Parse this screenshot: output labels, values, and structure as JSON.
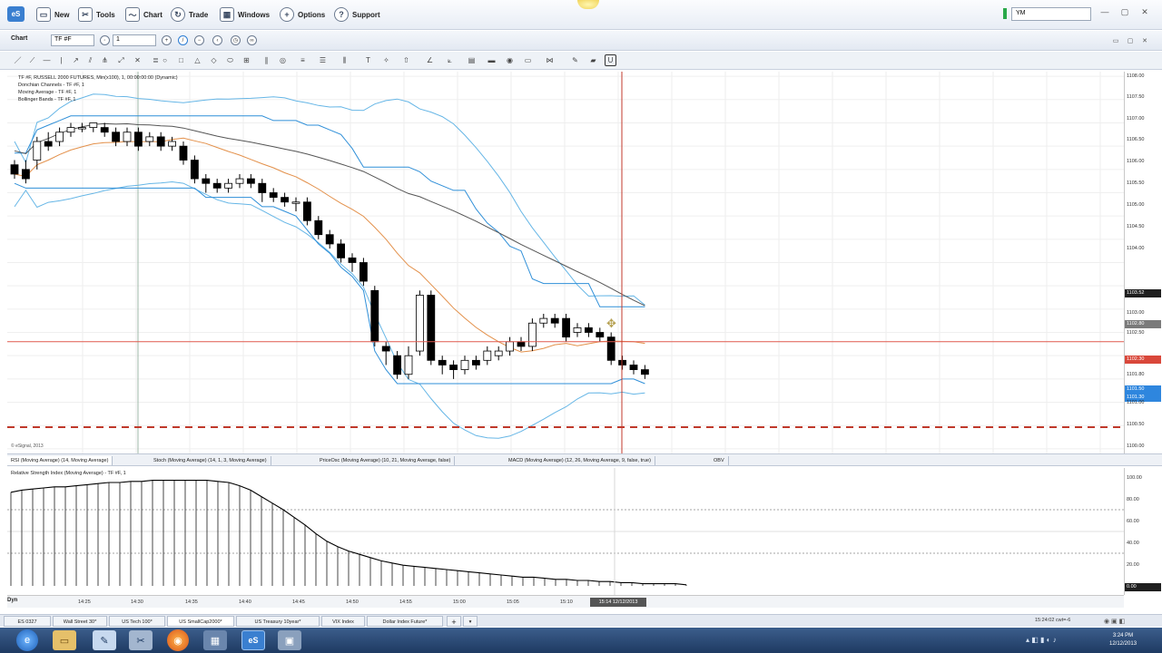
{
  "menu": {
    "items": [
      "New",
      "Tools",
      "Chart",
      "Trade",
      "Windows",
      "Options",
      "Support"
    ],
    "app_logo": "eS",
    "symbol": "YM"
  },
  "toolbar": {
    "chart_label": "Chart",
    "symbol": "TF #F",
    "interval": "1"
  },
  "chart_info": {
    "title": "TF #F, RUSSELL 2000 FUTURES, Min(x100), 1, 00:00:00:00 (Dynamic)",
    "studies": [
      "Donchian Channels - TF #F, 1",
      "Moving Average - TF #F, 1",
      "Bollinger Bands - TF #F, 1"
    ],
    "copyright": "© eSignal, 2013"
  },
  "price_axis": {
    "labels": [
      "1108.00",
      "1107.50",
      "1107.00",
      "1106.50",
      "1106.00",
      "1105.50",
      "1105.00",
      "1104.50",
      "1104.00",
      "1103.00",
      "1102.50",
      "1101.80",
      "1101.00",
      "1100.50",
      "1100.00"
    ],
    "badges": [
      {
        "text": "1103.52",
        "color": "#1f1f1f"
      },
      {
        "text": "1102.80",
        "color": "#7a7a7a"
      },
      {
        "text": "1102.30",
        "color": "#d9473a"
      },
      {
        "text": "1101.50",
        "color": "#2e86de"
      },
      {
        "text": "1101.30",
        "color": "#2e86de"
      }
    ]
  },
  "indicator_tabs": [
    "RSI (Moving Average) (14, Moving Average)",
    "Stoch (Moving Average) (14, 1, 3, Moving Average)",
    "PriceOsc (Moving Average) (10, 21, Moving Average, false)",
    "MACD (Moving Average) (12, 26, Moving Average, 9, false, true)",
    "OBV"
  ],
  "rsi": {
    "title": "Relative Strength Index (Moving Average) - TF #F, 1",
    "axis_labels": [
      "100.00",
      "80.00",
      "60.00",
      "40.00",
      "20.00",
      "0.00"
    ],
    "values": [
      86,
      88,
      89,
      90,
      91,
      91,
      92,
      93,
      94,
      95,
      95,
      96,
      96,
      97,
      97,
      97,
      97,
      97,
      97,
      96,
      95,
      92,
      88,
      82,
      76,
      70,
      63,
      56,
      48,
      41,
      36,
      32,
      29,
      26,
      23,
      21,
      19,
      18,
      17,
      16,
      15,
      14,
      13,
      12,
      11,
      10,
      9,
      8,
      8,
      7,
      6,
      6,
      5,
      5,
      4,
      4,
      3,
      3,
      2,
      2,
      2,
      2,
      1
    ]
  },
  "time_axis": {
    "labels": [
      "14:25",
      "14:30",
      "14:35",
      "14:40",
      "14:45",
      "14:50",
      "14:55",
      "15:00",
      "15:05",
      "15:10"
    ],
    "cursor_label": "15:14 12/12/2013",
    "corner": "Dyn"
  },
  "page_tabs": [
    "ES 0327",
    "Wall Street 30*",
    "US Tech 100*",
    "US SmallCap2000*",
    "US Treasury 10year*",
    "VIX Index",
    "Dollar Index Future*"
  ],
  "page_status": "15:24:02 cwt=-6",
  "taskbar": {
    "time": "3:24 PM",
    "date": "12/12/2013"
  },
  "candles": [
    {
      "o": 1106.1,
      "c": 1105.9,
      "h": 1106.2,
      "l": 1105.8
    },
    {
      "o": 1106.0,
      "c": 1105.8,
      "h": 1106.2,
      "l": 1105.7
    },
    {
      "o": 1106.2,
      "c": 1106.6,
      "h": 1106.7,
      "l": 1106.0
    },
    {
      "o": 1106.6,
      "c": 1106.5,
      "h": 1106.8,
      "l": 1106.4
    },
    {
      "o": 1106.6,
      "c": 1106.8,
      "h": 1106.9,
      "l": 1106.5
    },
    {
      "o": 1106.8,
      "c": 1106.9,
      "h": 1107.0,
      "l": 1106.7
    },
    {
      "o": 1106.9,
      "c": 1106.9,
      "h": 1107.0,
      "l": 1106.8
    },
    {
      "o": 1106.9,
      "c": 1107.0,
      "h": 1107.0,
      "l": 1106.8
    },
    {
      "o": 1106.9,
      "c": 1106.8,
      "h": 1107.0,
      "l": 1106.7
    },
    {
      "o": 1106.8,
      "c": 1106.6,
      "h": 1106.9,
      "l": 1106.5
    },
    {
      "o": 1106.6,
      "c": 1106.8,
      "h": 1106.9,
      "l": 1106.5
    },
    {
      "o": 1106.8,
      "c": 1106.5,
      "h": 1106.9,
      "l": 1106.4
    },
    {
      "o": 1106.6,
      "c": 1106.7,
      "h": 1106.8,
      "l": 1106.5
    },
    {
      "o": 1106.7,
      "c": 1106.5,
      "h": 1106.8,
      "l": 1106.4
    },
    {
      "o": 1106.5,
      "c": 1106.6,
      "h": 1106.7,
      "l": 1106.4
    },
    {
      "o": 1106.5,
      "c": 1106.2,
      "h": 1106.6,
      "l": 1106.1
    },
    {
      "o": 1106.2,
      "c": 1105.8,
      "h": 1106.3,
      "l": 1105.7
    },
    {
      "o": 1105.8,
      "c": 1105.7,
      "h": 1105.9,
      "l": 1105.5
    },
    {
      "o": 1105.7,
      "c": 1105.6,
      "h": 1105.8,
      "l": 1105.5
    },
    {
      "o": 1105.6,
      "c": 1105.7,
      "h": 1105.8,
      "l": 1105.5
    },
    {
      "o": 1105.7,
      "c": 1105.8,
      "h": 1105.9,
      "l": 1105.6
    },
    {
      "o": 1105.8,
      "c": 1105.7,
      "h": 1105.9,
      "l": 1105.6
    },
    {
      "o": 1105.7,
      "c": 1105.5,
      "h": 1105.8,
      "l": 1105.3
    },
    {
      "o": 1105.5,
      "c": 1105.4,
      "h": 1105.6,
      "l": 1105.3
    },
    {
      "o": 1105.4,
      "c": 1105.3,
      "h": 1105.5,
      "l": 1105.2
    },
    {
      "o": 1105.3,
      "c": 1105.3,
      "h": 1105.4,
      "l": 1105.1
    },
    {
      "o": 1105.3,
      "c": 1104.9,
      "h": 1105.4,
      "l": 1104.8
    },
    {
      "o": 1104.9,
      "c": 1104.6,
      "h": 1105.0,
      "l": 1104.5
    },
    {
      "o": 1104.6,
      "c": 1104.4,
      "h": 1104.7,
      "l": 1104.3
    },
    {
      "o": 1104.4,
      "c": 1104.1,
      "h": 1104.5,
      "l": 1104.0
    },
    {
      "o": 1104.1,
      "c": 1104.0,
      "h": 1104.2,
      "l": 1103.8
    },
    {
      "o": 1104.0,
      "c": 1103.6,
      "h": 1104.1,
      "l": 1103.5
    },
    {
      "o": 1103.4,
      "c": 1102.3,
      "h": 1103.5,
      "l": 1102.2
    },
    {
      "o": 1102.2,
      "c": 1102.1,
      "h": 1102.3,
      "l": 1101.8
    },
    {
      "o": 1102.0,
      "c": 1101.6,
      "h": 1102.1,
      "l": 1101.5
    },
    {
      "o": 1101.6,
      "c": 1102.0,
      "h": 1102.2,
      "l": 1101.5
    },
    {
      "o": 1102.1,
      "c": 1103.3,
      "h": 1103.4,
      "l": 1102.0
    },
    {
      "o": 1103.3,
      "c": 1101.9,
      "h": 1103.4,
      "l": 1101.8
    },
    {
      "o": 1101.9,
      "c": 1101.8,
      "h": 1102.0,
      "l": 1101.6
    },
    {
      "o": 1101.8,
      "c": 1101.7,
      "h": 1101.9,
      "l": 1101.5
    },
    {
      "o": 1101.7,
      "c": 1101.9,
      "h": 1102.0,
      "l": 1101.6
    },
    {
      "o": 1101.9,
      "c": 1101.8,
      "h": 1102.0,
      "l": 1101.7
    },
    {
      "o": 1101.9,
      "c": 1102.1,
      "h": 1102.2,
      "l": 1101.8
    },
    {
      "o": 1102.0,
      "c": 1102.1,
      "h": 1102.2,
      "l": 1101.9
    },
    {
      "o": 1102.1,
      "c": 1102.3,
      "h": 1102.4,
      "l": 1102.0
    },
    {
      "o": 1102.3,
      "c": 1102.2,
      "h": 1102.4,
      "l": 1102.1
    },
    {
      "o": 1102.2,
      "c": 1102.7,
      "h": 1102.8,
      "l": 1102.1
    },
    {
      "o": 1102.7,
      "c": 1102.8,
      "h": 1102.9,
      "l": 1102.6
    },
    {
      "o": 1102.8,
      "c": 1102.7,
      "h": 1102.9,
      "l": 1102.6
    },
    {
      "o": 1102.8,
      "c": 1102.4,
      "h": 1102.9,
      "l": 1102.3
    },
    {
      "o": 1102.5,
      "c": 1102.6,
      "h": 1102.7,
      "l": 1102.4
    },
    {
      "o": 1102.6,
      "c": 1102.5,
      "h": 1102.7,
      "l": 1102.4
    },
    {
      "o": 1102.5,
      "c": 1102.4,
      "h": 1102.6,
      "l": 1102.3
    },
    {
      "o": 1102.4,
      "c": 1101.9,
      "h": 1102.5,
      "l": 1101.8
    },
    {
      "o": 1101.9,
      "c": 1101.8,
      "h": 1102.0,
      "l": 1101.7
    },
    {
      "o": 1101.8,
      "c": 1101.7,
      "h": 1101.9,
      "l": 1101.6
    },
    {
      "o": 1101.7,
      "c": 1101.6,
      "h": 1101.8,
      "l": 1101.5
    }
  ]
}
